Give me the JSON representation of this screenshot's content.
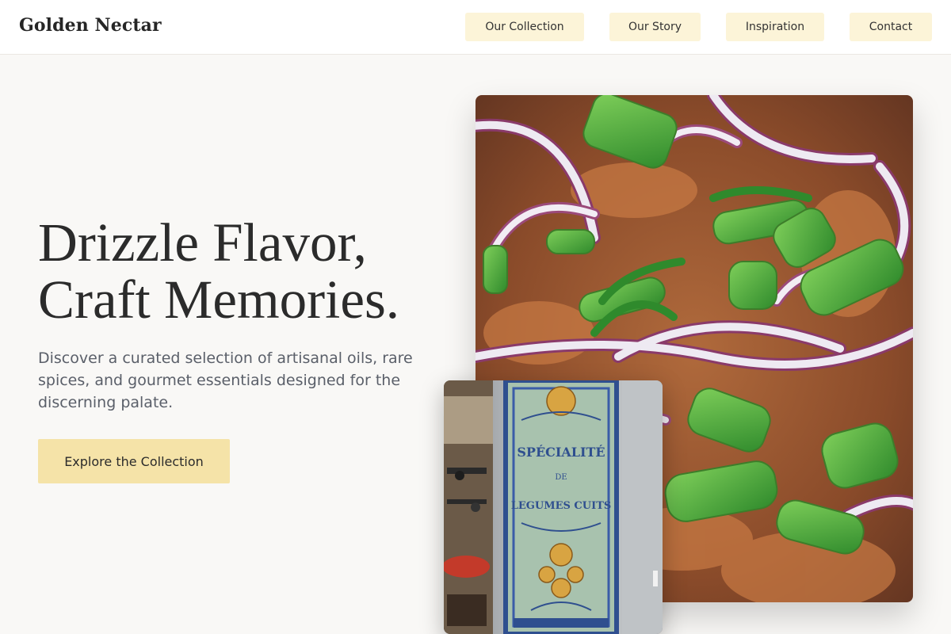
{
  "brand": {
    "name": "Golden Nectar"
  },
  "nav": {
    "items": [
      {
        "label": "Our Collection"
      },
      {
        "label": "Our Story"
      },
      {
        "label": "Inspiration"
      },
      {
        "label": "Contact"
      }
    ]
  },
  "hero": {
    "title_line1": "Drizzle Flavor,",
    "title_line2": "Craft Memories.",
    "description": "Discover a curated selection of artisanal oils, rare spices, and gourmet essentials designed for the discerning palate.",
    "cta_label": "Explore the Collection"
  },
  "images": {
    "main_photo_icon": "food-photo",
    "small_photo_icon": "shop-window-photo",
    "sign_line1": "SPÉCIALITÉ",
    "sign_line2": "DE",
    "sign_line3": "LEGUMES CUITS"
  },
  "colors": {
    "accent": "#f5e3a8",
    "nav_button": "#fcf4d8",
    "background": "#f9f8f6"
  }
}
